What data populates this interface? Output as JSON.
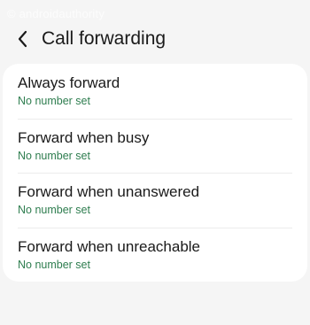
{
  "watermark": "© androidauthority",
  "header": {
    "title": "Call forwarding",
    "back_icon": "chevron-left-icon"
  },
  "options": [
    {
      "title": "Always forward",
      "subtitle": "No number set"
    },
    {
      "title": "Forward when busy",
      "subtitle": "No number set"
    },
    {
      "title": "Forward when unanswered",
      "subtitle": "No number set"
    },
    {
      "title": "Forward when unreachable",
      "subtitle": "No number set"
    }
  ],
  "colors": {
    "background": "#f5f5f5",
    "card": "#ffffff",
    "subtitle": "#2e7d4f",
    "text": "#1a1a1a"
  }
}
